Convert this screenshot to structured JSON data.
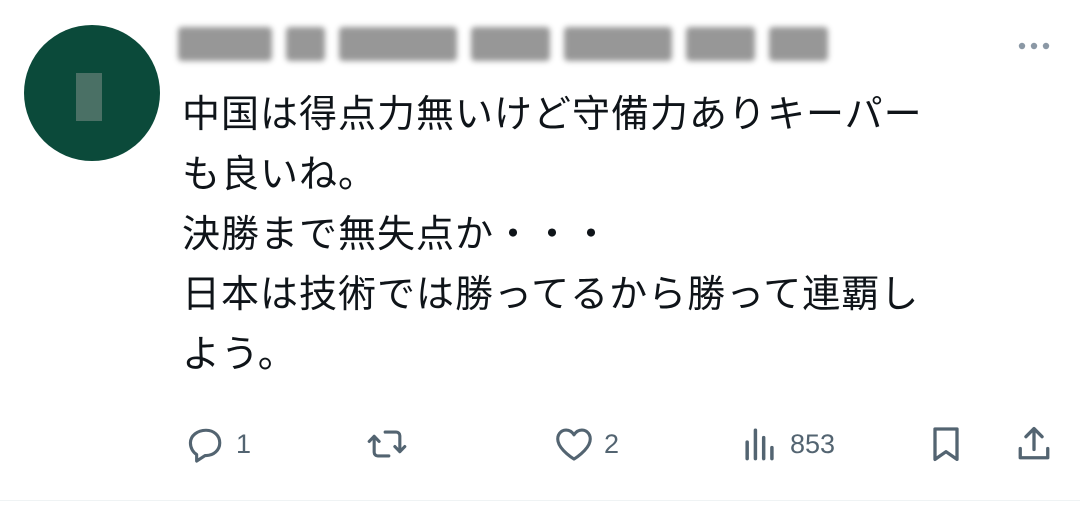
{
  "post": {
    "text": "中国は得点力無いけど守備力ありキーパー\nも良いね。\n決勝まで無失点か・・・\n日本は技術では勝ってるから勝って連覇し\nよう。",
    "actions": {
      "reply_count": "1",
      "like_count": "2",
      "view_count": "853"
    },
    "icons": {
      "more": "more-horizontal-icon",
      "reply": "reply-icon",
      "retweet": "retweet-icon",
      "like": "heart-icon",
      "views": "views-chart-icon",
      "bookmark": "bookmark-icon",
      "share": "share-icon"
    },
    "colors": {
      "text": "#0f1419",
      "icon": "#536471",
      "avatar": "#0b4a3a"
    }
  }
}
